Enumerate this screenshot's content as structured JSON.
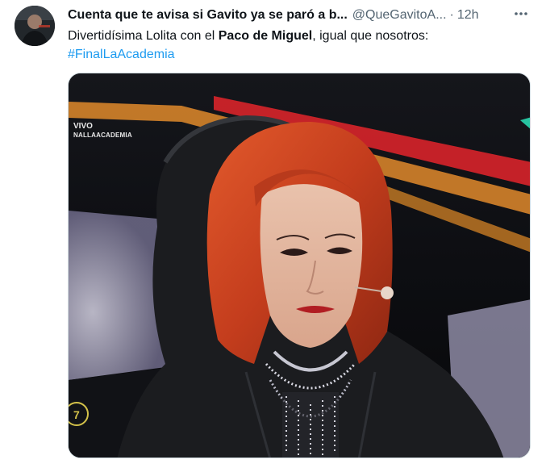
{
  "tweet": {
    "display_name": "Cuenta que te avisa si Gavito ya se paró a b...",
    "handle": "@QueGavitoA...",
    "separator": "·",
    "time": "12h",
    "text_part1": "Divertidísima Lolita con el ",
    "text_bold": "Paco de Miguel",
    "text_part2": ", igual que nosotros:",
    "hashtag": "#FinalLaAcademia"
  },
  "media": {
    "broadcast_live": "VIVO",
    "broadcast_tag": "NALLAACADEMIA"
  },
  "icons": {
    "more": "more-horizontal-icon",
    "avatar": "profile-avatar"
  },
  "colors": {
    "text_primary": "#0f1419",
    "text_secondary": "#536471",
    "link": "#1d9bf0"
  }
}
